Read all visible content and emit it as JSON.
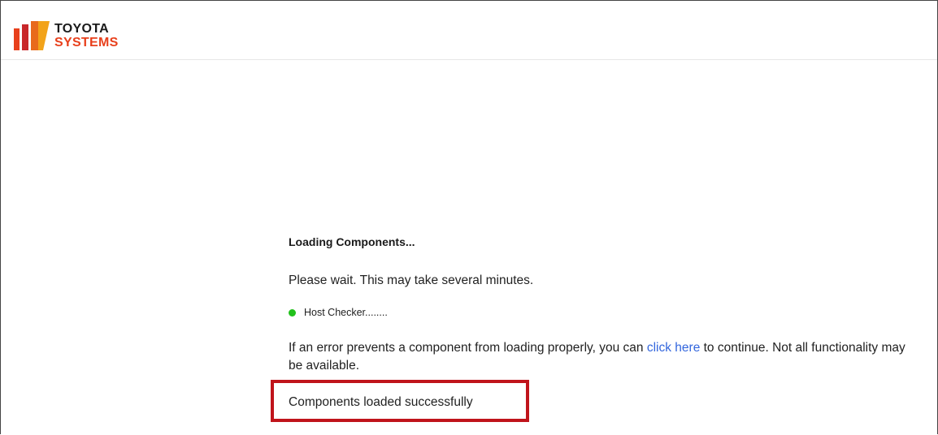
{
  "header": {
    "logo": {
      "line1": "TOYOTA",
      "line2": "SYSTEMS",
      "colors": {
        "bar_left": "#e8401c",
        "bar_mid": "#c8282a",
        "bar_right": "#f2a31a",
        "text_dark": "#1a1a1a",
        "text_accent": "#e8401c"
      }
    }
  },
  "loading": {
    "heading": "Loading Components...",
    "wait_message": "Please wait. This may take several minutes.",
    "host_checker": {
      "label": "Host Checker........",
      "status_color": "#22c11c"
    },
    "error_message": {
      "before_link": "If an error prevents a component from loading properly, you can ",
      "link_text": "click here",
      "after_link": " to continue. Not all functionality may be available."
    },
    "success_message": "Components loaded successfully",
    "highlight_color": "#c0141b"
  }
}
